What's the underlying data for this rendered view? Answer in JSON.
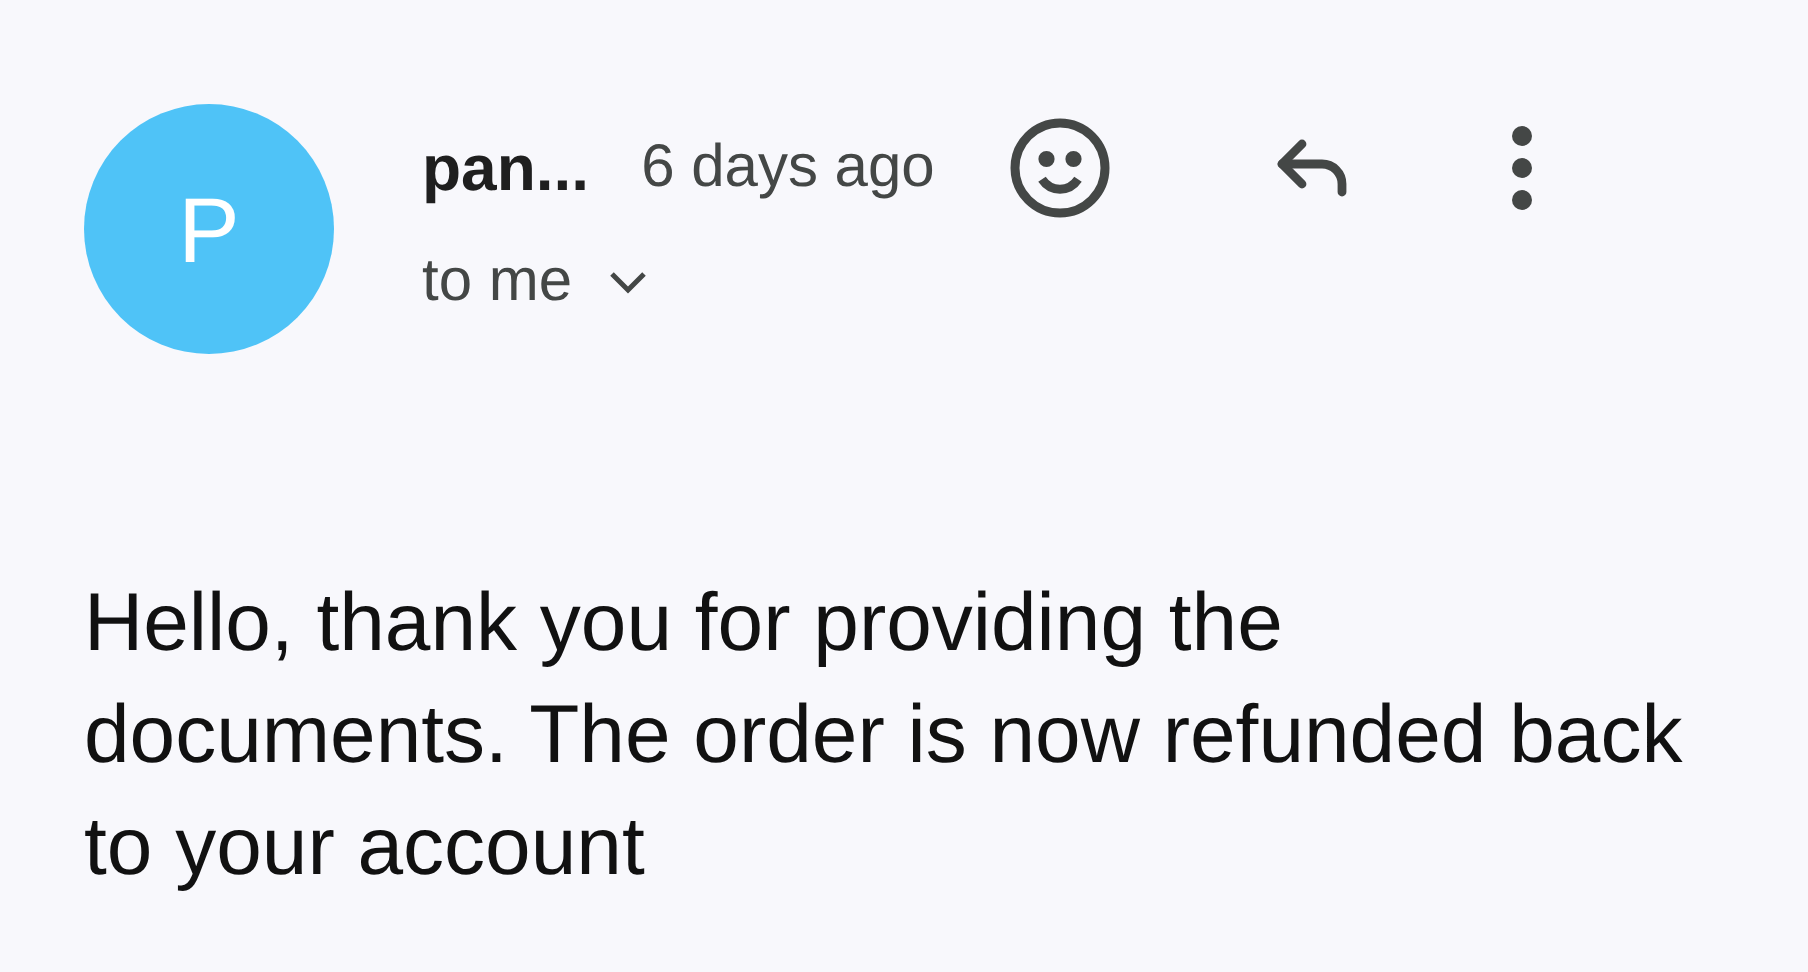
{
  "message": {
    "avatar_letter": "P",
    "sender": "pan...",
    "time": "6 days ago",
    "recipient": "to me",
    "body": "Hello, thank you for providing the documents. The order is now refunded back to your account"
  }
}
